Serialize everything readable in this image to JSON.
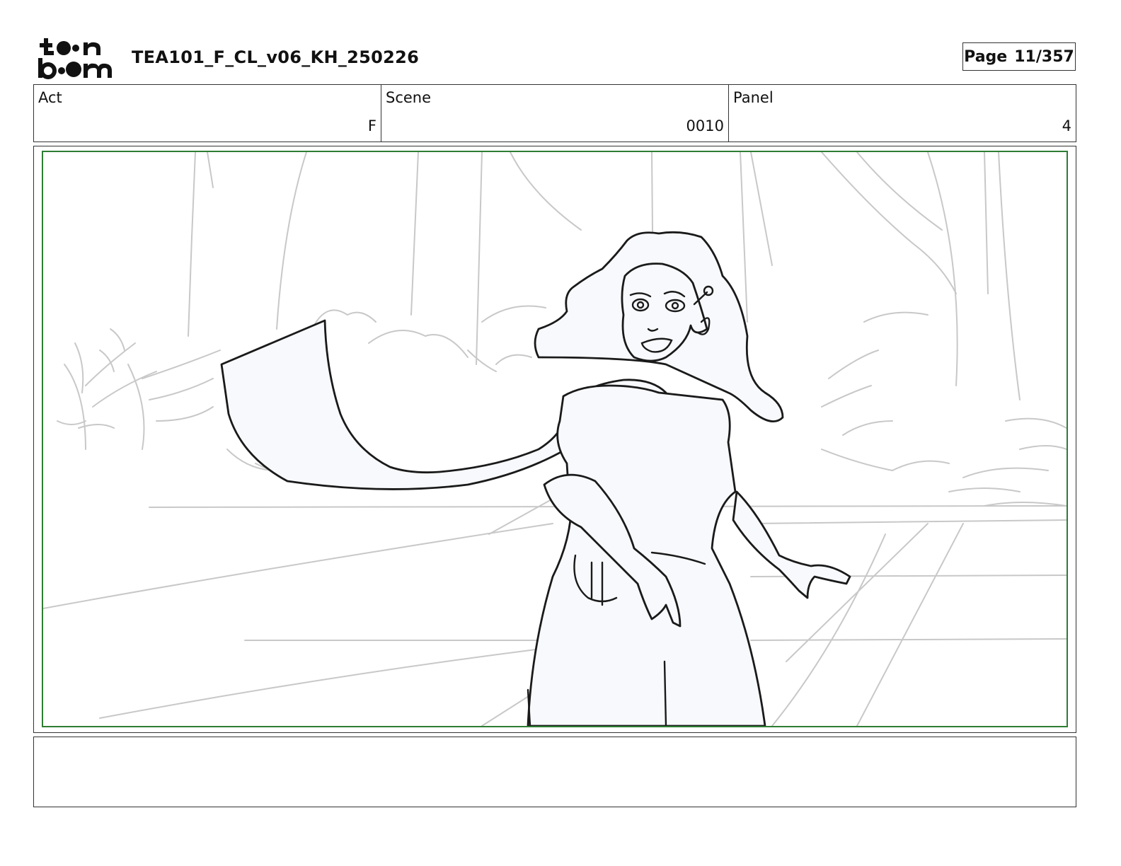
{
  "header": {
    "logo_text": "toon boom",
    "doc_title": "TEA101_F_CL_v06_KH_250226",
    "page_label": "Page",
    "page_value": "11/357"
  },
  "info": {
    "act_label": "Act",
    "act_value": "F",
    "scene_label": "Scene",
    "scene_value": "0010",
    "panel_label": "Panel",
    "panel_value": "4"
  },
  "panel": {
    "frame_color": "#2e7d32",
    "sketch_background_color": "#c8c8c8",
    "sketch_figure_color": "#1a1a1a",
    "figure_fill_color": "#f7f9fc"
  },
  "notes": {
    "text": ""
  }
}
